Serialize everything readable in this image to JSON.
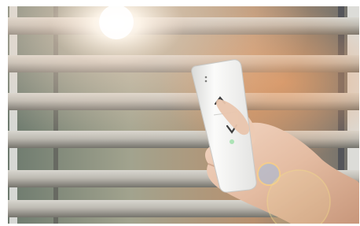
{
  "scene": {
    "subject": "hand-holding-blind-remote",
    "colors": {
      "backdrop": "#8d8e8a",
      "slat_light": "#c9c7c0",
      "slat_shadow": "#6f6e68",
      "warm_glow": "#f3a36a",
      "sun_flare": "#fffaf0",
      "remote_body": "#f4f4f2",
      "skin": "#e8c2a8",
      "skin_shadow": "#b98a70"
    },
    "remote": {
      "buttons": [
        "up-arrow",
        "down-arrow"
      ],
      "indicator_dots": 2
    },
    "lens_flares": 3
  }
}
